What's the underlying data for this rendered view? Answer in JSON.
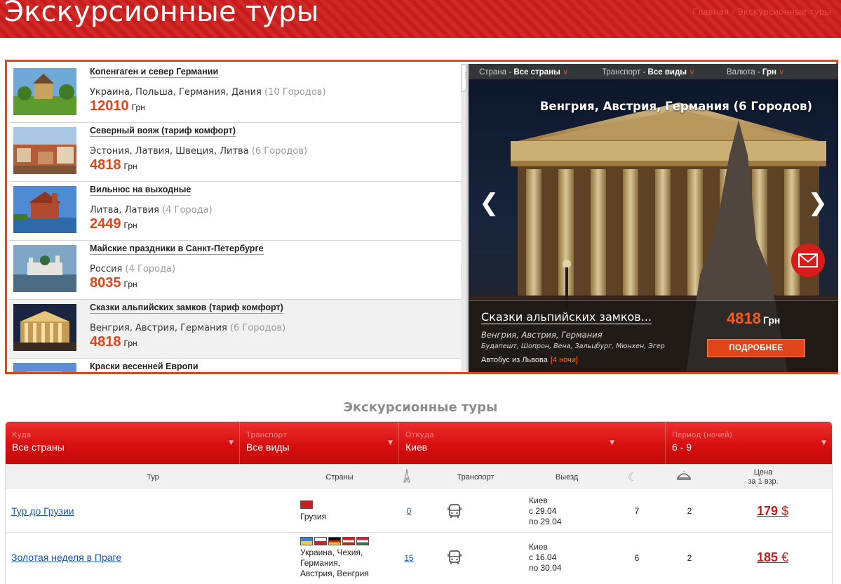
{
  "header": {
    "title": "Экскурсионные туры",
    "breadcrumb": "Главная › Экскурсионные туры"
  },
  "tour_list": [
    {
      "title": "Копенгаген и север Германии",
      "countries": "Украина, Польша, Германия, Дания",
      "cities": "(10 Городов)",
      "price": "12010",
      "currency": "Грн",
      "thumb": "church-green-field",
      "active": false
    },
    {
      "title": "Северный вояж (тариф комфорт)",
      "countries": "Эстония, Латвия, Швеция, Литва",
      "cities": "(6 Городов)",
      "price": "4818",
      "currency": "Грн",
      "thumb": "old-town-roofs",
      "active": false
    },
    {
      "title": "Вильнюс на выходные",
      "countries": "Литва, Латвия",
      "cities": "(4 Города)",
      "price": "2449",
      "currency": "Грн",
      "thumb": "lake-castle",
      "active": false
    },
    {
      "title": "Майские праздники в Санкт-Петербурге",
      "countries": "Россия",
      "cities": "(4 Города)",
      "price": "8035",
      "currency": "Грн",
      "thumb": "monastery-water",
      "active": false
    },
    {
      "title": "Сказки альпийских замков (тариф комфорт)",
      "countries": "Венгрия, Австрия, Германия",
      "cities": "(6 Городов)",
      "price": "4818",
      "currency": "Грн",
      "thumb": "parliament-night",
      "active": true
    },
    {
      "title": "Краски весенней Европи",
      "countries": "",
      "cities": "",
      "price": "",
      "currency": "",
      "thumb": "blue-sky-building",
      "active": false
    }
  ],
  "hero": {
    "filters": [
      {
        "label": "Страна",
        "value": "Все страны"
      },
      {
        "label": "Транспорт",
        "value": "Все виды"
      },
      {
        "label": "Валюта",
        "value": "Грн"
      }
    ],
    "title": "Венгрия, Австрия, Германия (6 Городов)",
    "prev_icon": "chevron-left-icon",
    "next_icon": "chevron-right-icon",
    "mail_icon": "envelope-icon",
    "caption": {
      "tour_title": "Сказки альпийских замков...",
      "countries": "Венгрия, Австрия, Германия",
      "cities": "Будапешт, Шопрон, Вена, Зальцбург, Мюнхен, Эгер",
      "transport": "Автобус из Львова",
      "nights": "[4 ночи]",
      "price": "4818",
      "currency": "Грн",
      "more_button": "ПОДРОБНЕЕ"
    }
  },
  "results": {
    "section_title": "Экскурсионные туры",
    "filters": [
      {
        "label": "Куда",
        "value": "Все страны"
      },
      {
        "label": "Транспорт",
        "value": "Все виды"
      },
      {
        "label": "Откуда",
        "value": "Киев"
      },
      {
        "label": "Период (ночей)",
        "value": "6 - 9"
      }
    ],
    "columns": {
      "tour": "Тур",
      "countries": "Страны",
      "sights_icon": "eiffel-tower-icon",
      "transport": "Транспорт",
      "departure": "Выезд",
      "nights_icon": "moon-icon",
      "meals_icon": "dish-icon",
      "price_line1": "Цена",
      "price_line2": "за 1 взр."
    },
    "rows": [
      {
        "tour": "Тур до Грузии",
        "flags": [
          "#c81e1e"
        ],
        "countries": [
          "Грузия"
        ],
        "sights": "0",
        "transport_icon": "bus-icon",
        "departure_city": "Киев",
        "departure_from": "с 29.04",
        "departure_to": "по 29.04",
        "nights": "7",
        "meals": "2",
        "price": "179",
        "currency": "$"
      },
      {
        "tour": "Золотая неделя в Праге",
        "flags": [
          "#3d7fd6",
          "#d11d2b",
          "#000000",
          "#d41f1f",
          "#cd2a3e"
        ],
        "countries": [
          "Украина, Чехия,",
          "Германия,",
          "Австрия, Венгрия"
        ],
        "sights": "15",
        "transport_icon": "bus-icon",
        "departure_city": "Киев",
        "departure_from": "с 16.04",
        "departure_to": "по 30.04",
        "nights": "6",
        "meals": "2",
        "price": "185",
        "currency": "€"
      }
    ]
  }
}
